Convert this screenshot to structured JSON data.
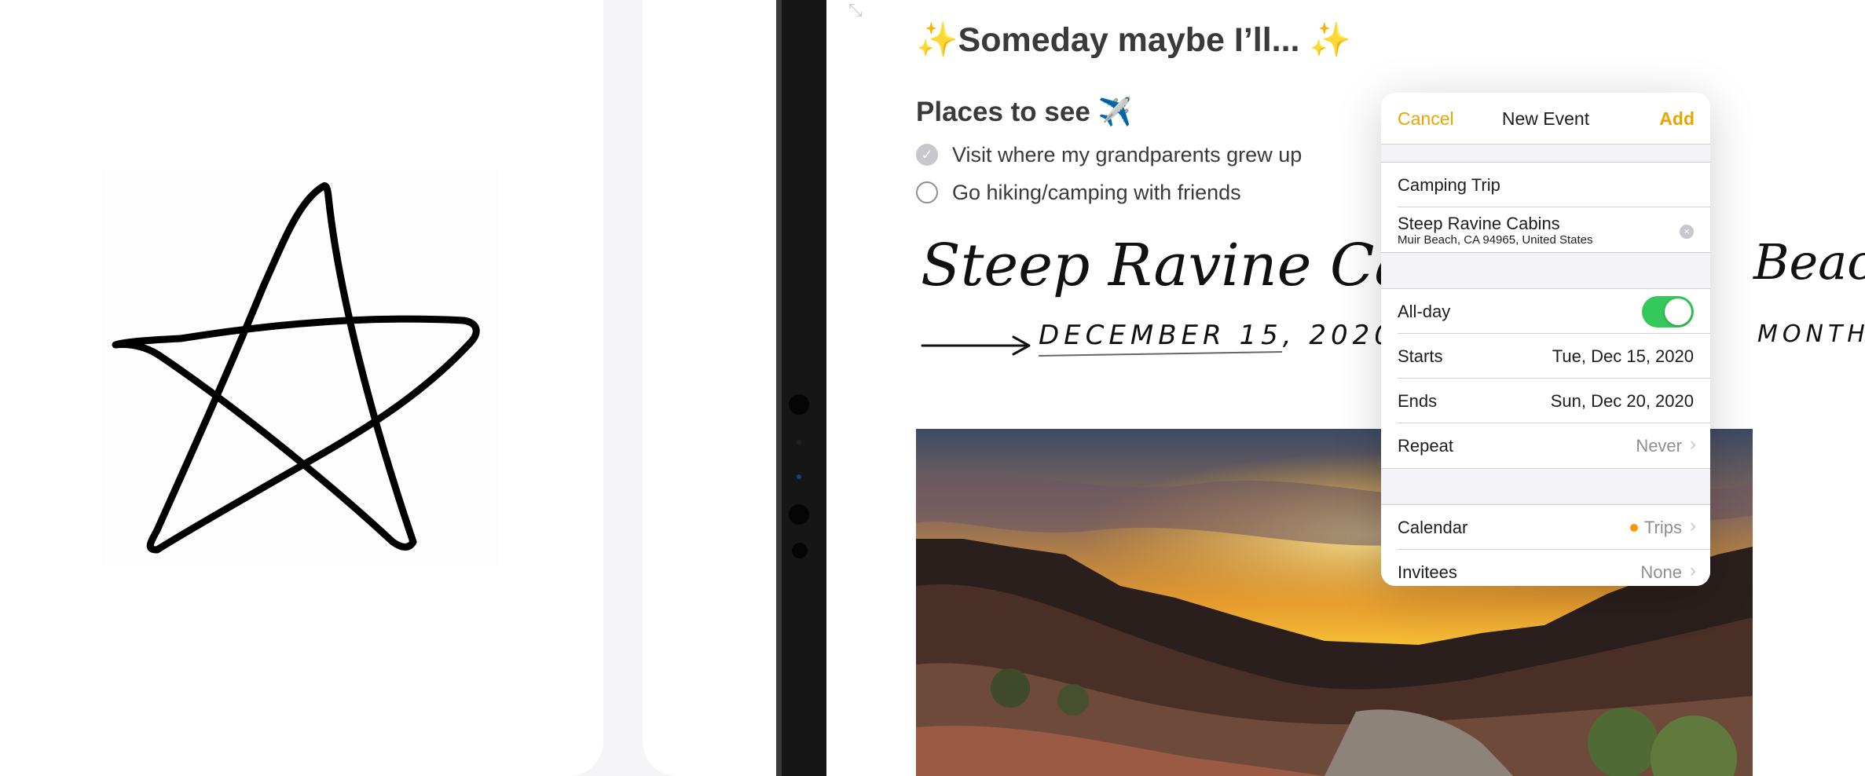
{
  "note": {
    "title": "✨Someday maybe I’ll... ✨",
    "section_heading": "Places to see ✈️",
    "checklist": [
      {
        "label": "Visit where my grandparents grew up",
        "checked": true
      },
      {
        "label": "Go hiking/camping with friends",
        "checked": false
      }
    ],
    "handwriting": {
      "line1_left": "Steep Ravine Cabins",
      "line1_right": "Beach",
      "line2_date": "DECEMBER 15, 2020",
      "line2_right": "MONTHS"
    }
  },
  "event_popover": {
    "cancel_label": "Cancel",
    "title": "New Event",
    "add_label": "Add",
    "event_title": "Camping Trip",
    "location": "Steep Ravine Cabins",
    "location_address": "Muir Beach, CA 94965, United States",
    "all_day_label": "All-day",
    "all_day_on": true,
    "starts_label": "Starts",
    "starts_value": "Tue, Dec 15, 2020",
    "ends_label": "Ends",
    "ends_value": "Sun, Dec 20, 2020",
    "repeat_label": "Repeat",
    "repeat_value": "Never",
    "calendar_label": "Calendar",
    "calendar_value": "Trips",
    "calendar_color": "#ff9500",
    "invitees_label": "Invitees",
    "invitees_value": "None"
  },
  "colors": {
    "accent": "#e6a700",
    "toggle_on": "#34c759"
  }
}
